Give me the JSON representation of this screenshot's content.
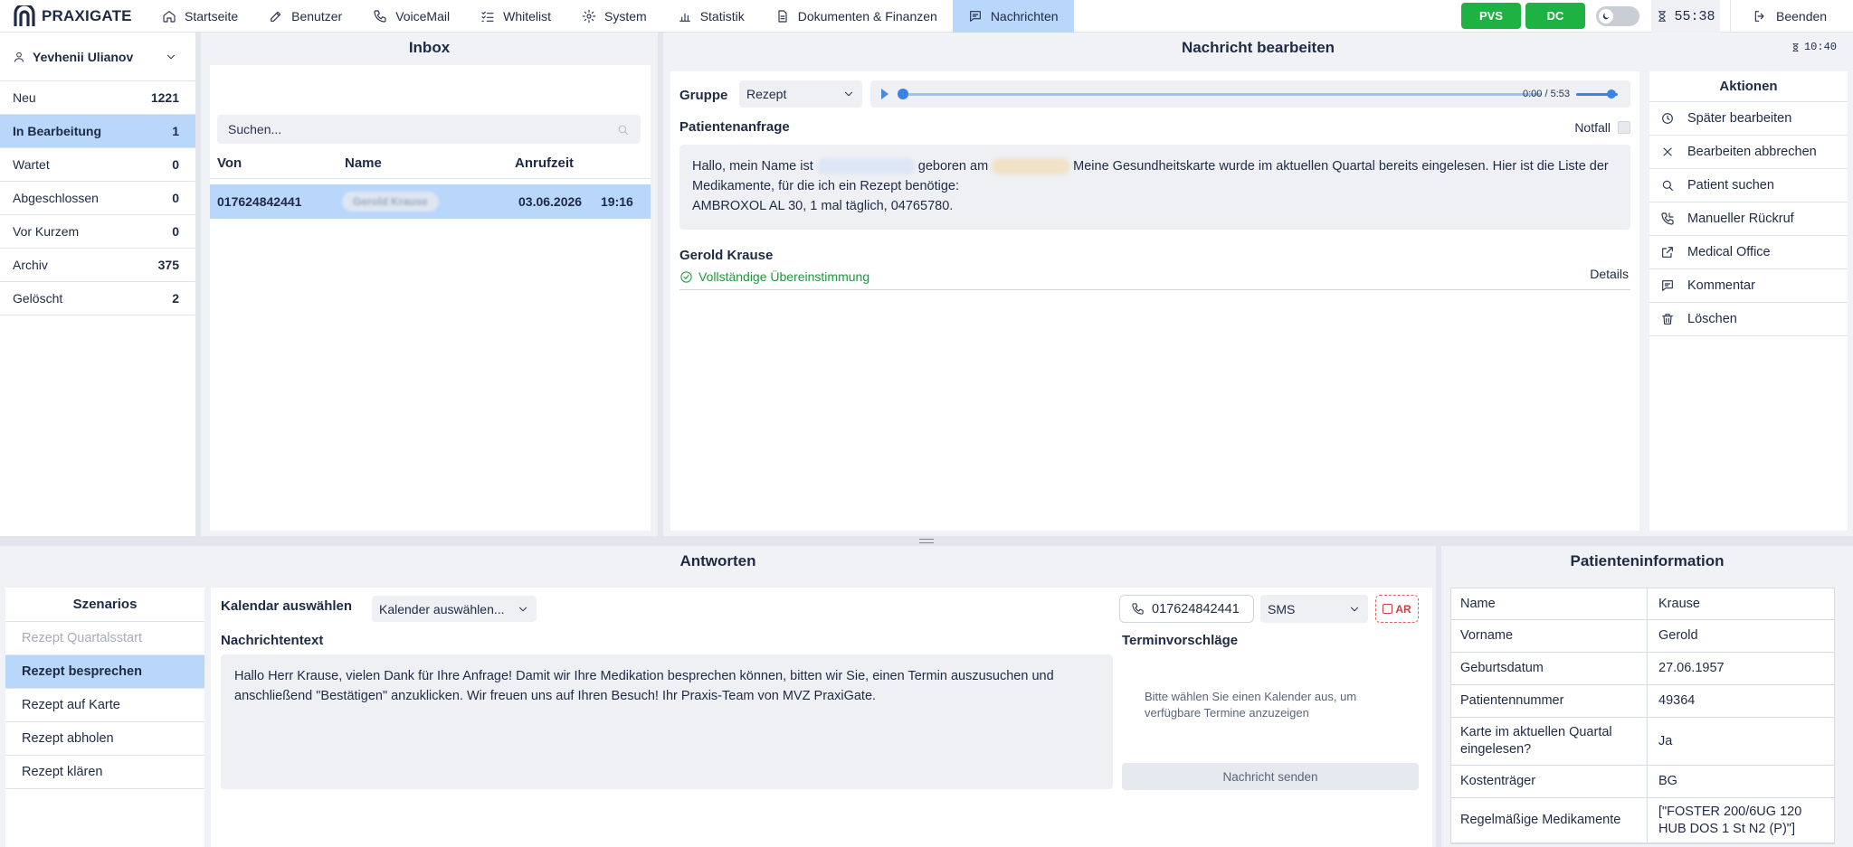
{
  "app": {
    "name": "PRAXIGATE"
  },
  "nav": [
    {
      "label": "Startseite",
      "icon": "home-icon"
    },
    {
      "label": "Benutzer",
      "icon": "edit-icon"
    },
    {
      "label": "VoiceMail",
      "icon": "phone-icon"
    },
    {
      "label": "Whitelist",
      "icon": "checklist-icon"
    },
    {
      "label": "System",
      "icon": "gear-icon"
    },
    {
      "label": "Statistik",
      "icon": "bar-chart-icon"
    },
    {
      "label": "Dokumenten & Finanzen",
      "icon": "document-icon"
    },
    {
      "label": "Nachrichten",
      "icon": "message-icon"
    }
  ],
  "topbar": {
    "pvs": "PVS",
    "dc": "DC",
    "timer": "55:38",
    "logout": "Beenden"
  },
  "user": {
    "name": "Yevhenii Ulianov"
  },
  "statuses": [
    {
      "label": "Neu",
      "count": "1221"
    },
    {
      "label": "In Bearbeitung",
      "count": "1"
    },
    {
      "label": "Wartet",
      "count": "0"
    },
    {
      "label": "Abgeschlossen",
      "count": "0"
    },
    {
      "label": "Vor Kurzem",
      "count": "0"
    },
    {
      "label": "Archiv",
      "count": "375"
    },
    {
      "label": "Gelöscht",
      "count": "2"
    }
  ],
  "inbox": {
    "title": "Inbox",
    "search_placeholder": "Suchen...",
    "columns": {
      "from": "Von",
      "name": "Name",
      "time": "Anrufzeit"
    },
    "rows": [
      {
        "from": "017624842441",
        "name": "Gerold Krause",
        "date": "03.06.2026",
        "time": "19:16"
      }
    ]
  },
  "editor": {
    "title": "Nachricht bearbeiten",
    "clock": "10:40",
    "gruppe_label": "Gruppe",
    "gruppe_value": "Rezept",
    "audio_time": "0:00 / 5:53",
    "anfrage_title": "Patientenanfrage",
    "notfall": "Notfall",
    "anfrage": {
      "p1": "Hallo, mein Name ist",
      "p2": "geboren am",
      "p3": "Meine Gesundheitskarte wurde im aktuellen Quartal bereits eingelesen. Hier ist die Liste der Medikamente, für die ich ein Rezept benötige:",
      "p4": "AMBROXOL AL 30, 1 mal täglich, 04765780."
    },
    "match_name": "Gerold Krause",
    "match_status": "Vollständige Übereinstimmung",
    "details": "Details"
  },
  "actions": {
    "title": "Aktionen",
    "items": [
      {
        "label": "Später bearbeiten",
        "icon": "clock-icon"
      },
      {
        "label": "Bearbeiten abbrechen",
        "icon": "close-icon"
      },
      {
        "label": "Patient suchen",
        "icon": "search-icon"
      },
      {
        "label": "Manueller Rückruf",
        "icon": "phone-callback-icon"
      },
      {
        "label": "Medical Office",
        "icon": "external-link-icon"
      },
      {
        "label": "Kommentar",
        "icon": "comment-icon"
      },
      {
        "label": "Löschen",
        "icon": "trash-icon"
      }
    ]
  },
  "reply": {
    "title": "Antworten",
    "scenarios_title": "Szenarios",
    "scenarios": [
      "Rezept Quartalsstart",
      "Rezept besprechen",
      "Rezept auf Karte",
      "Rezept abholen",
      "Rezept klären"
    ],
    "kalender_label": "Kalendar auswählen",
    "kalender_value": "Kalender auswählen...",
    "phone": "017624842441",
    "channel": "SMS",
    "ar": "AR",
    "msg_label": "Nachrichtentext",
    "msg_text": "Hallo Herr Krause, vielen Dank für Ihre Anfrage! Damit wir Ihre Medikation besprechen können, bitten wir Sie, einen Termin auszusuchen und anschließend \"Bestätigen\" anzuklicken. Wir freuen uns auf Ihren Besuch! Ihr Praxis-Team von MVZ PraxiGate.",
    "termin_label": "Terminvorschläge",
    "termin_hint": "Bitte wählen Sie einen Kalender aus, um verfügbare Termine anzuzeigen",
    "send": "Nachricht senden"
  },
  "patient": {
    "title": "Patienteninformation",
    "rows": [
      {
        "k": "Name",
        "v": "Krause"
      },
      {
        "k": "Vorname",
        "v": "Gerold"
      },
      {
        "k": "Geburtsdatum",
        "v": "27.06.1957"
      },
      {
        "k": "Patientennummer",
        "v": "49364"
      },
      {
        "k": "Karte im aktuellen Quartal eingelesen?",
        "v": "Ja"
      },
      {
        "k": "Kostenträger",
        "v": "BG"
      },
      {
        "k": "Regelmäßige Medikamente",
        "v": "[\"FOSTER 200/6UG 120 HUB DOS 1 St N2 (P)\"]"
      }
    ]
  },
  "colors": {
    "active": "#b9d6fb",
    "green": "#1eb243",
    "match_green": "#1b9a3c",
    "accent": "#3b82e6"
  }
}
